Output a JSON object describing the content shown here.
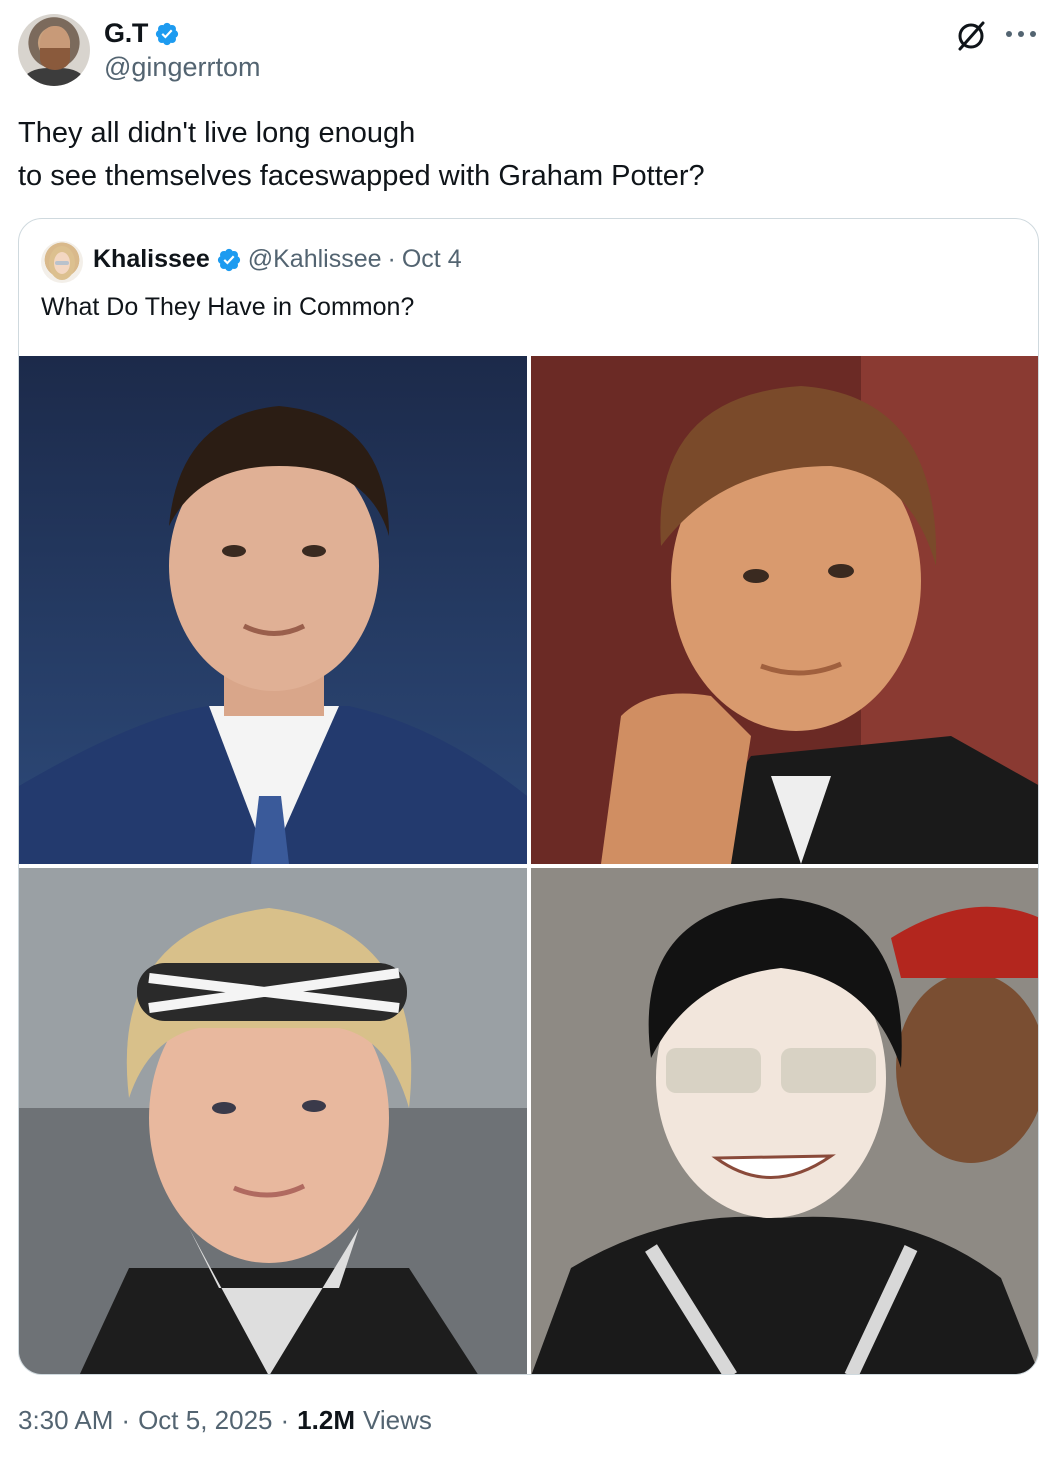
{
  "author": {
    "display_name": "G.T",
    "handle": "@gingerrtom",
    "verified_icon": "verified-badge-icon"
  },
  "tweet": {
    "text_lines": [
      "They all didn't live long enough",
      "to see themselves faceswapped with Graham Potter?"
    ]
  },
  "quoted": {
    "display_name": "Khalissee",
    "handle": "@Kahlissee",
    "separator": "·",
    "date": "Oct 4",
    "text": "What Do They Have in Common?",
    "images": [
      "man-in-blue-pinstripe-suit-photo",
      "man-with-hand-on-chin-photo",
      "woman-in-houndstooth-headband-photo",
      "man-in-mirrored-sunglasses-photo"
    ]
  },
  "footer": {
    "time": "3:30 AM",
    "sep1": "·",
    "date": "Oct 5, 2025",
    "sep2": "·",
    "views_count": "1.2M",
    "views_label": "Views"
  },
  "colors": {
    "text": "#0f1419",
    "secondary": "#536471",
    "verified": "#1d9bf0",
    "border": "#cfd9de"
  }
}
